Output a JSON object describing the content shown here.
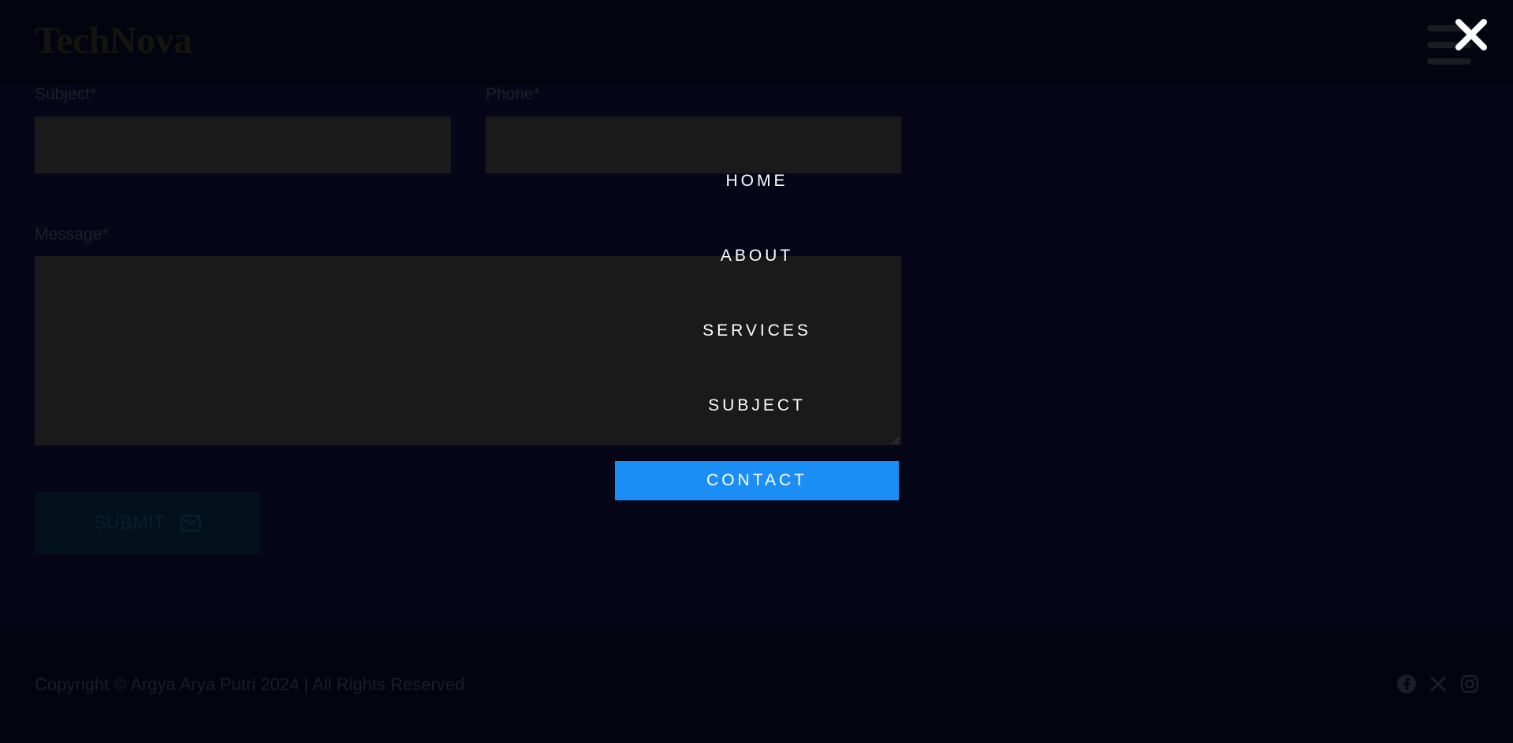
{
  "brand": {
    "name": "TechNova"
  },
  "form": {
    "subject_label": "Subject*",
    "phone_label": "Phone*",
    "message_label": "Message*",
    "subject_value": "",
    "phone_value": "",
    "message_value": "",
    "submit_label": "SUBMIT"
  },
  "nav": {
    "items": [
      {
        "label": "HOME"
      },
      {
        "label": "ABOUT"
      },
      {
        "label": "SERVICES"
      },
      {
        "label": "SUBJECT"
      },
      {
        "label": "CONTACT",
        "active": true
      }
    ]
  },
  "footer": {
    "copyright": "Copyright © Argya Arya Putri 2024 | All Rights Reserved",
    "socials": [
      "facebook-icon",
      "x-icon",
      "instagram-icon"
    ]
  },
  "colors": {
    "background": "#050714",
    "accent": "#1a8ef5",
    "field": "#1a1a1b",
    "text_on_overlay": "#ffffff"
  }
}
